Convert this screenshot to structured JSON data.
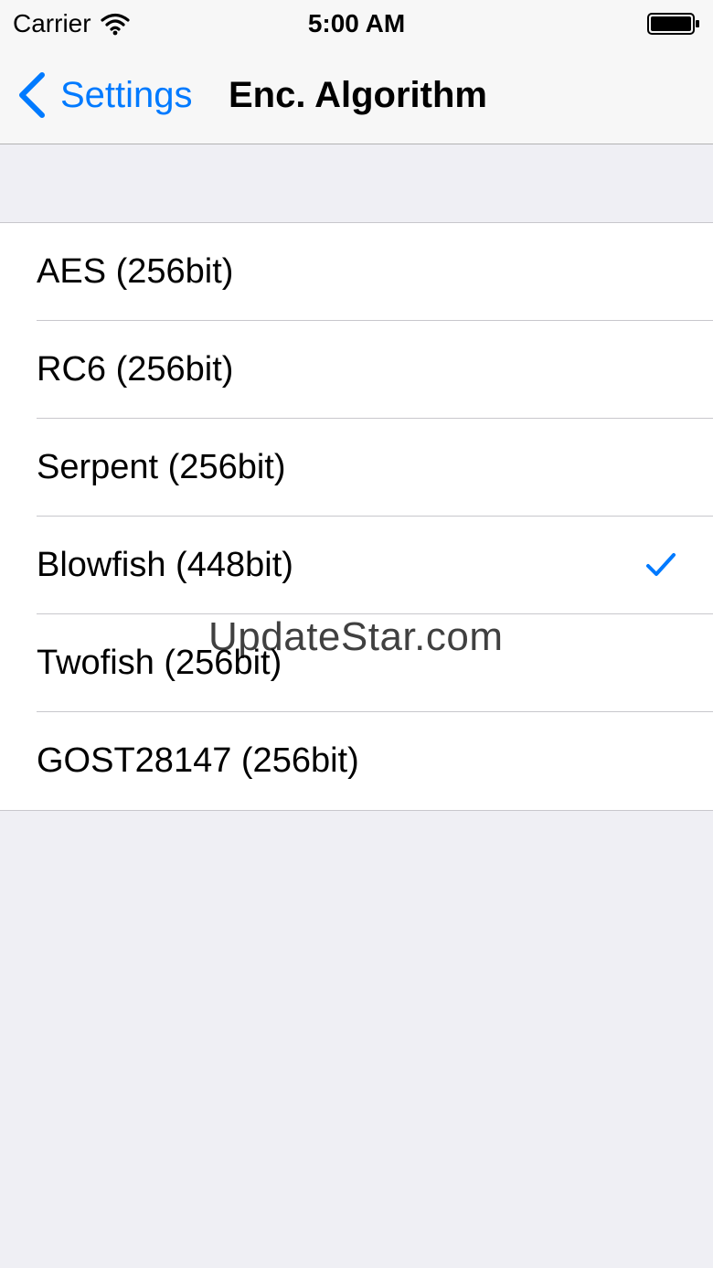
{
  "status_bar": {
    "carrier": "Carrier",
    "time": "5:00 AM",
    "icons": [
      "wifi-icon",
      "battery-icon"
    ]
  },
  "nav": {
    "back_label": "Settings",
    "title": "Enc. Algorithm",
    "accent_color": "#007aff"
  },
  "algorithms": {
    "items": [
      {
        "label": "AES (256bit)",
        "selected": false
      },
      {
        "label": "RC6 (256bit)",
        "selected": false
      },
      {
        "label": "Serpent (256bit)",
        "selected": false
      },
      {
        "label": "Blowfish (448bit)",
        "selected": true
      },
      {
        "label": "Twofish (256bit)",
        "selected": false
      },
      {
        "label": "GOST28147 (256bit)",
        "selected": false
      }
    ]
  },
  "watermark": "UpdateStar.com"
}
